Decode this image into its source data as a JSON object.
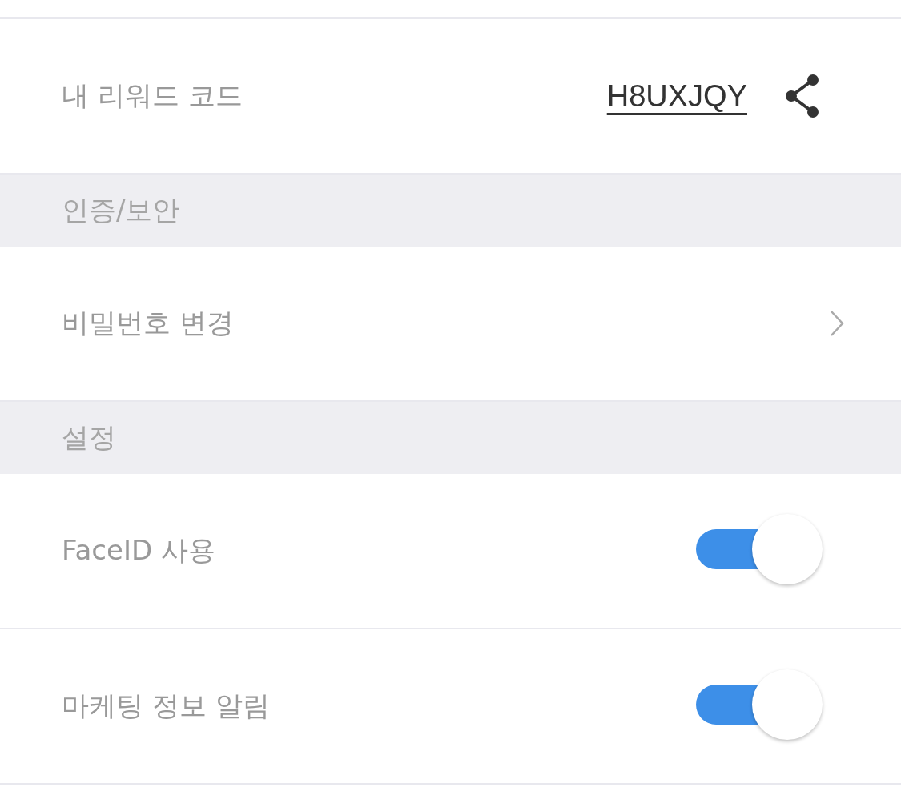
{
  "rows": [
    {
      "kind": "code",
      "label": "내 리워드 코드",
      "code": "H8UXJQY"
    },
    {
      "kind": "section",
      "label": "인증/보안"
    },
    {
      "kind": "link",
      "label": "비밀번호 변경"
    },
    {
      "kind": "section",
      "label": "설정"
    },
    {
      "kind": "toggle",
      "label": "FaceID 사용",
      "on": true
    },
    {
      "kind": "toggle",
      "label": "마케팅 정보 알림",
      "on": true
    }
  ]
}
